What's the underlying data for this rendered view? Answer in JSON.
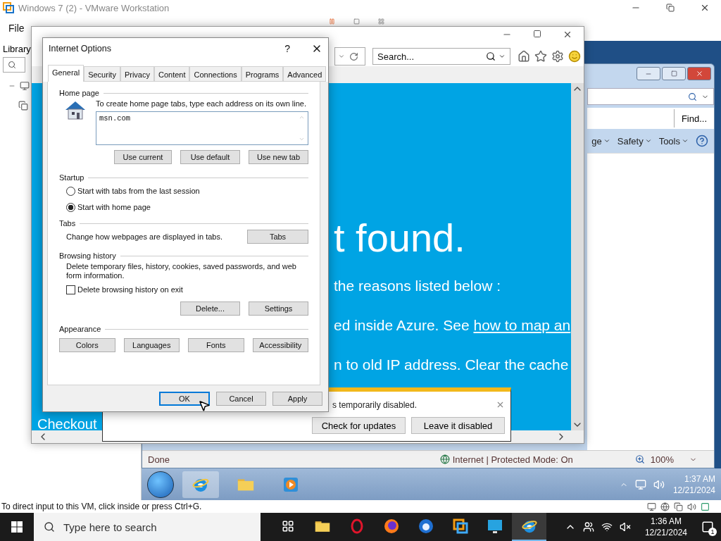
{
  "vmware": {
    "title": "Windows 7 (2) - VMware Workstation",
    "menu": [
      "File"
    ],
    "library": {
      "title": "Library"
    },
    "status": "To direct input to this VM, click inside or press Ctrl+G."
  },
  "guest": {
    "ie_window": {
      "find_button": "Find...",
      "commands": [
        {
          "label": "ge"
        },
        {
          "label": "Safety"
        },
        {
          "label": "Tools"
        }
      ],
      "status": "Done",
      "zone": "Internet | Protected Mode: On",
      "zoom": "100%"
    },
    "taskbar": {
      "time": "1:37 AM",
      "date": "12/21/2024"
    }
  },
  "browser": {
    "search": {
      "placeholder": "Search..."
    },
    "page": {
      "rows": [
        {
          "text": "t found.",
          "kind": "headline"
        },
        {
          "text": "the reasons listed below :",
          "kind": "line"
        },
        {
          "text": "ed inside Azure. See ",
          "link": "how to map an",
          "kind": "line"
        },
        {
          "text": "n to old IP address. Clear the cache",
          "kind": "line"
        }
      ],
      "footer": "Checkout"
    },
    "notification": {
      "message": "s temporarily disabled.",
      "buttons": [
        "Check for updates",
        "Leave it disabled"
      ]
    }
  },
  "dialog": {
    "title": "Internet Options",
    "help": "?",
    "tabs": [
      {
        "label": "General",
        "selected": true
      },
      {
        "label": "Security",
        "selected": false
      },
      {
        "label": "Privacy",
        "selected": false
      },
      {
        "label": "Content",
        "selected": false
      },
      {
        "label": "Connections",
        "selected": false
      },
      {
        "label": "Programs",
        "selected": false
      },
      {
        "label": "Advanced",
        "selected": false
      }
    ],
    "home_page": {
      "title": "Home page",
      "hint": "To create home page tabs, type each address on its own line.",
      "value": "msn.com",
      "buttons": [
        "Use current",
        "Use default",
        "Use new tab"
      ]
    },
    "startup": {
      "title": "Startup",
      "options": [
        {
          "label": "Start with tabs from the last session",
          "selected": false
        },
        {
          "label": "Start with home page",
          "selected": true
        }
      ]
    },
    "tabs_group": {
      "title": "Tabs",
      "text": "Change how webpages are displayed in tabs.",
      "button": "Tabs"
    },
    "history": {
      "title": "Browsing history",
      "text": "Delete temporary files, history, cookies, saved passwords, and web form information.",
      "checkbox": {
        "label": "Delete browsing history on exit",
        "checked": false
      },
      "buttons": [
        "Delete...",
        "Settings"
      ]
    },
    "appearance": {
      "title": "Appearance",
      "buttons": [
        "Colors",
        "Languages",
        "Fonts",
        "Accessibility"
      ]
    },
    "footer": [
      {
        "label": "OK",
        "default": true
      },
      {
        "label": "Cancel",
        "default": false
      },
      {
        "label": "Apply",
        "default": false
      }
    ]
  },
  "host_taskbar": {
    "search": {
      "placeholder": "Type here to search"
    },
    "time": "1:36 AM",
    "date": "12/21/2024",
    "notifications": "1"
  }
}
